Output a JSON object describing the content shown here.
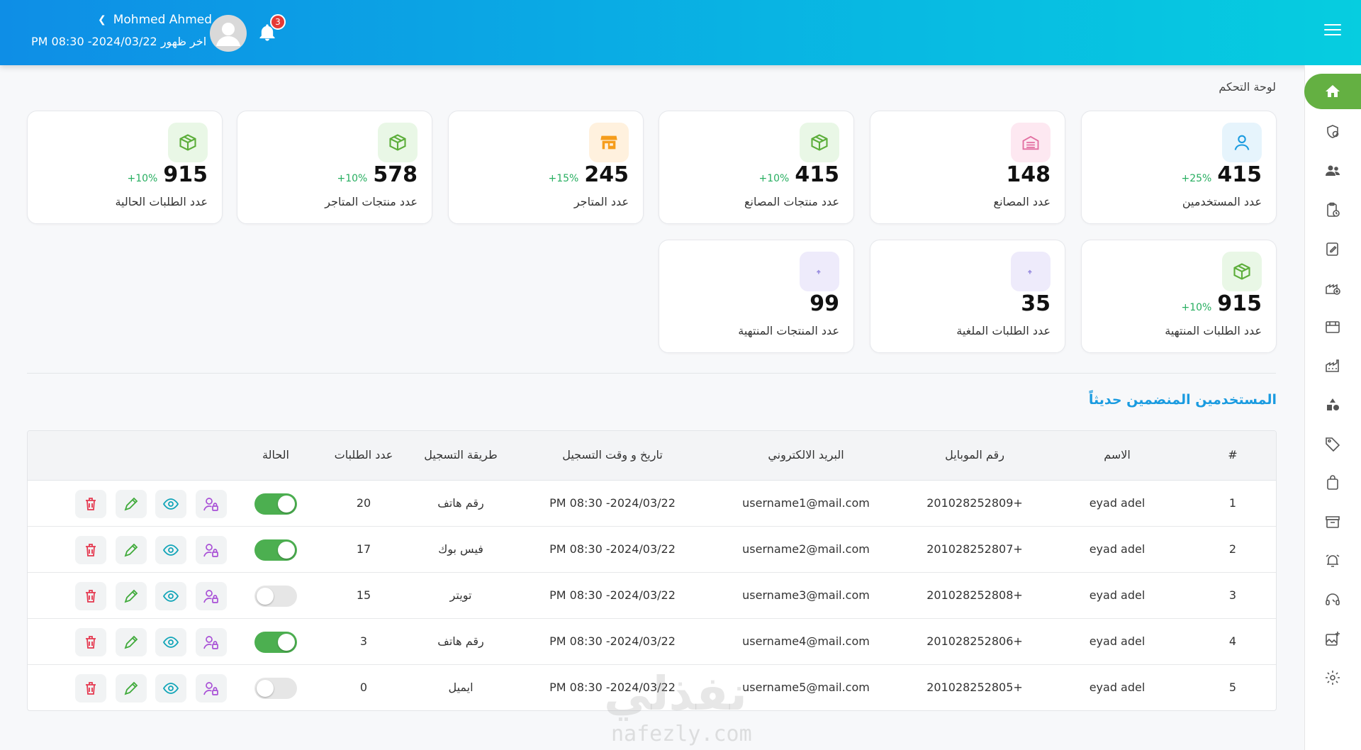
{
  "header": {
    "user_name": "Mohmed Ahmed",
    "last_seen": "اخر ظهور 2024/03/22- 08:30 PM",
    "notification_count": "3"
  },
  "breadcrumb": "لوحة التحكم",
  "stats": [
    {
      "value": "415",
      "pct": "+25%",
      "label": "عدد المستخدمين",
      "icon": "user-icon",
      "color": "#1a9be0",
      "bg": "#e6f4fc"
    },
    {
      "value": "148",
      "pct": "",
      "label": "عدد المصانع",
      "icon": "factory-icon",
      "color": "#e26fa1",
      "bg": "#fde8f1"
    },
    {
      "value": "415",
      "pct": "+10%",
      "label": "عدد منتجات المصانع",
      "icon": "box-icon",
      "color": "#5cae3a",
      "bg": "#e9f7e6"
    },
    {
      "value": "245",
      "pct": "+15%",
      "label": "عدد المتاجر",
      "icon": "store-icon",
      "color": "#f59d1c",
      "bg": "#fff1de"
    },
    {
      "value": "578",
      "pct": "+10%",
      "label": "عدد منتجات المتاجر",
      "icon": "box-icon",
      "color": "#5cae3a",
      "bg": "#e9f7e6"
    },
    {
      "value": "915",
      "pct": "+10%",
      "label": "عدد الطلبات الحالية",
      "icon": "box-icon",
      "color": "#5cae3a",
      "bg": "#e9f7e6"
    },
    {
      "value": "915",
      "pct": "+10%",
      "label": "عدد الطلبات المنتهية",
      "icon": "box-icon",
      "color": "#5cae3a",
      "bg": "#e9f7e6"
    },
    {
      "value": "35",
      "pct": "",
      "label": "عدد الطلبات الملغية",
      "icon": "cancel-icon",
      "color": "#9b8fe0",
      "bg": "#eeebfb"
    },
    {
      "value": "99",
      "pct": "",
      "label": "عدد المنتجات المنتهية",
      "icon": "cancel-icon",
      "color": "#9b8fe0",
      "bg": "#eeebfb"
    }
  ],
  "section_title": "المستخدمين المنضمين حديثاً",
  "table": {
    "headers": {
      "index": "#",
      "name": "الاسم",
      "mobile": "رقم الموبايل",
      "email": "البريد الالكتروني",
      "date": "تاريخ و وقت التسجيل",
      "method": "طريقة التسجيل",
      "orders": "عدد الطلبات",
      "status": "الحالة"
    },
    "rows": [
      {
        "index": "1",
        "name": "eyad adel",
        "mobile": "201028252809+",
        "email": "username1@mail.com",
        "date": "2024/03/22- 08:30 PM",
        "method": "رقم هاتف",
        "orders": "20",
        "active": true
      },
      {
        "index": "2",
        "name": "eyad adel",
        "mobile": "201028252807+",
        "email": "username2@mail.com",
        "date": "2024/03/22- 08:30 PM",
        "method": "فيس بوك",
        "orders": "17",
        "active": true
      },
      {
        "index": "3",
        "name": "eyad adel",
        "mobile": "201028252808+",
        "email": "username3@mail.com",
        "date": "2024/03/22- 08:30 PM",
        "method": "تويتر",
        "orders": "15",
        "active": false
      },
      {
        "index": "4",
        "name": "eyad adel",
        "mobile": "201028252806+",
        "email": "username4@mail.com",
        "date": "2024/03/22- 08:30 PM",
        "method": "رقم هاتف",
        "orders": "3",
        "active": true
      },
      {
        "index": "5",
        "name": "eyad adel",
        "mobile": "201028252805+",
        "email": "username5@mail.com",
        "date": "2024/03/22- 08:30 PM",
        "method": "ايميل",
        "orders": "0",
        "active": false
      }
    ]
  },
  "colors": {
    "header_start": "#0e8ee6",
    "header_end": "#06cde0",
    "active_nav": "#64b042",
    "title_blue": "#1a9be0",
    "toggle_on": "#4caf50",
    "delete_red": "#e53950",
    "edit_green": "#3faa3a",
    "view_teal": "#12a5b8",
    "role_purple": "#a84fd6"
  },
  "sidebar_icons": [
    "home-icon",
    "shield-user-icon",
    "users-icon",
    "clipboard-clock-icon",
    "edit-document-icon",
    "factory-add-icon",
    "store-icon",
    "factory-icon",
    "shapes-icon",
    "tag-icon",
    "shopping-bag-icon",
    "gift-box-icon",
    "alarm-icon",
    "support-headset-icon",
    "add-image-icon",
    "settings-gear-icon"
  ],
  "watermark": {
    "ar": "نفذلي",
    "en": "nafezly.com"
  }
}
